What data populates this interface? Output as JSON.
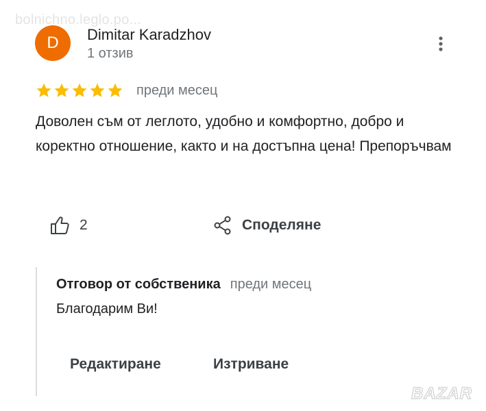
{
  "watermark": {
    "top_text": "bolnichno.leglo.po...",
    "logo_text": "BAZAR"
  },
  "review": {
    "avatar_letter": "D",
    "avatar_color": "#ef6c00",
    "author": "Dimitar Karadzhov",
    "review_count": "1 отзив",
    "rating": 5,
    "time": "преди месец",
    "text": "Доволен съм от леглото, удобно и комфортно, добро и коректно отношение, както и на достъпна цена! Препоръчвам",
    "star_color": "#fbbc04"
  },
  "actions": {
    "like_count": "2",
    "share_label": "Споделяне"
  },
  "reply": {
    "owner_label": "Отговор от собственика",
    "time": "преди месец",
    "text": "Благодарим Ви!",
    "edit_label": "Редактиране",
    "delete_label": "Изтриване"
  },
  "icons": {
    "more": "more-vert-icon",
    "star": "star-icon",
    "like": "thumb-up-icon",
    "share": "share-icon"
  }
}
